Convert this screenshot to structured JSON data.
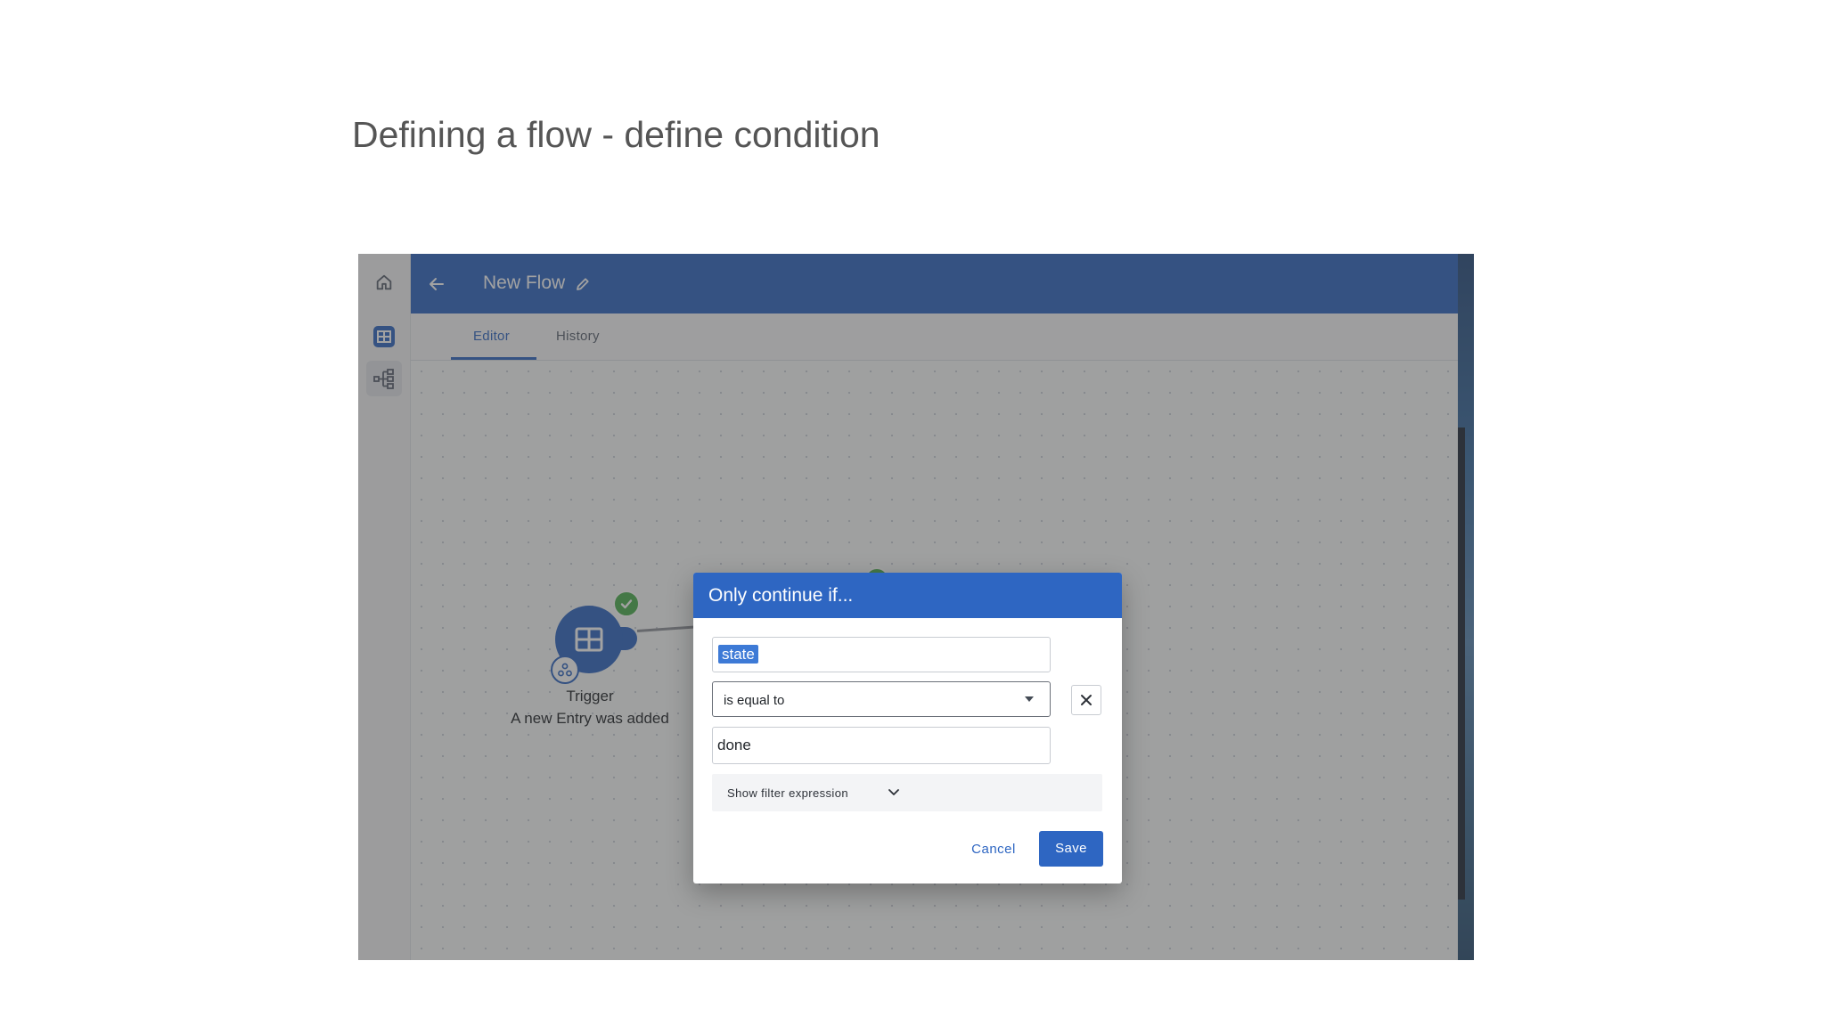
{
  "slide": {
    "title": "Defining a flow - define condition"
  },
  "sidebar": {
    "items": [
      {
        "name": "home",
        "icon": "home-icon"
      },
      {
        "name": "tables",
        "icon": "table-icon"
      },
      {
        "name": "flows",
        "icon": "flow-icon"
      }
    ]
  },
  "header": {
    "title": "New Flow",
    "back_icon": "arrow-left-icon",
    "edit_icon": "pencil-icon"
  },
  "tabs": [
    {
      "label": "Editor",
      "active": true
    },
    {
      "label": "History",
      "active": false
    }
  ],
  "canvas": {
    "trigger_node": {
      "title": "Trigger",
      "subtitle": "A new Entry was added",
      "icon": "table-icon",
      "status_icon": "check-circle-icon",
      "badge_icon": "webhook-icon"
    }
  },
  "dialog": {
    "title": "Only continue if...",
    "field_value": "state",
    "operator_value": "is equal to",
    "compare_value": "done",
    "remove_icon": "close-icon",
    "expression_toggle_label": "Show filter expression",
    "cancel_label": "Cancel",
    "save_label": "Save"
  },
  "colors": {
    "primary": "#2e66c2",
    "success": "#4caf50",
    "slide_title": "#555555"
  }
}
